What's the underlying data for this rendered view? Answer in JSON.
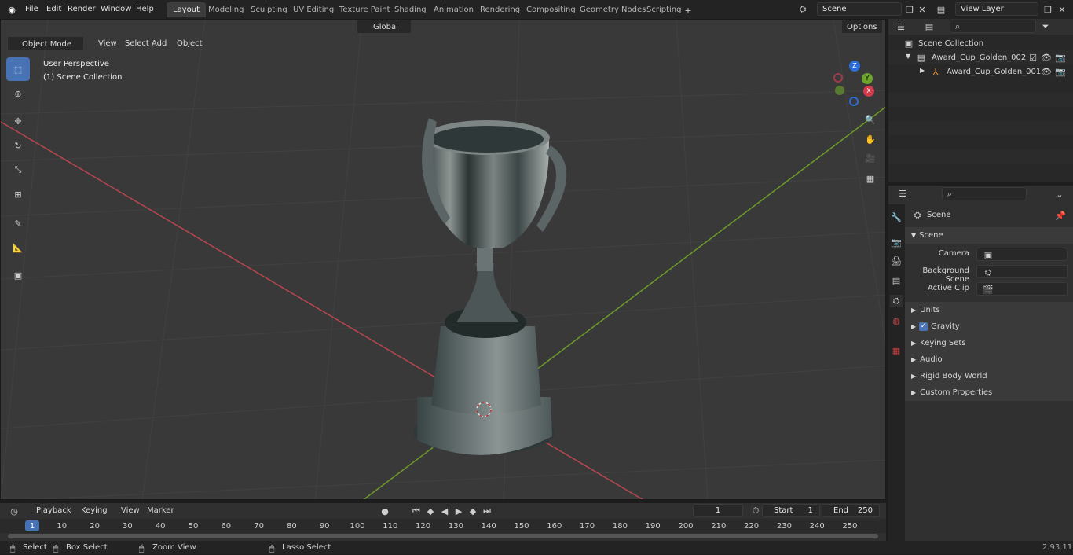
{
  "menu": [
    "File",
    "Edit",
    "Render",
    "Window",
    "Help"
  ],
  "workspaces": [
    "Layout",
    "Modeling",
    "Sculpting",
    "UV Editing",
    "Texture Paint",
    "Shading",
    "Animation",
    "Rendering",
    "Compositing",
    "Geometry Nodes",
    "Scripting"
  ],
  "active_workspace": "Layout",
  "scene_name": "Scene",
  "view_layer": "View Layer",
  "header": {
    "mode": "Object Mode",
    "view": "View",
    "select": "Select",
    "add": "Add",
    "object": "Object",
    "transform": "Global",
    "options": "Options"
  },
  "viewport": {
    "line1": "User Perspective",
    "line2": "(1) Scene Collection"
  },
  "gizmo": {
    "z": "Z",
    "y": "Y",
    "x": "X"
  },
  "outliner": {
    "collection": "Scene Collection",
    "items": [
      {
        "name": "Award_Cup_Golden_002"
      },
      {
        "name": "Award_Cup_Golden_001"
      }
    ]
  },
  "properties": {
    "tab_title": "Scene",
    "section": "Scene",
    "fields": [
      {
        "label": "Camera"
      },
      {
        "label": "Background Scene"
      },
      {
        "label": "Active Clip"
      }
    ],
    "panels": [
      "Units",
      "Gravity",
      "Keying Sets",
      "Audio",
      "Rigid Body World",
      "Custom Properties"
    ]
  },
  "timeline": {
    "playback": "Playback",
    "keying": "Keying",
    "view": "View",
    "marker": "Marker",
    "current_frame": "1",
    "start_label": "Start",
    "start": "1",
    "end_label": "End",
    "end": "250",
    "ruler": [
      "1",
      "10",
      "20",
      "30",
      "40",
      "50",
      "60",
      "70",
      "80",
      "90",
      "100",
      "110",
      "120",
      "130",
      "140",
      "150",
      "160",
      "170",
      "180",
      "190",
      "200",
      "210",
      "220",
      "230",
      "240",
      "250"
    ]
  },
  "status": {
    "select": "Select",
    "box_select": "Box Select",
    "zoom_view": "Zoom View",
    "lasso_select": "Lasso Select",
    "version": "2.93.11"
  },
  "colors": {
    "accent": "#4772b3",
    "x_axis": "#b8464f",
    "y_axis": "#6d9a2a"
  }
}
